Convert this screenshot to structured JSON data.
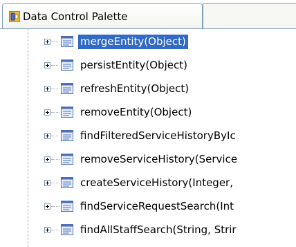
{
  "tab": {
    "title": "Data Control Palette",
    "icon": "data-control-palette-icon"
  },
  "tree": {
    "items": [
      {
        "label": "mergeEntity(Object)",
        "selected": true,
        "icon": "method-icon"
      },
      {
        "label": "persistEntity(Object)",
        "selected": false,
        "icon": "method-icon"
      },
      {
        "label": "refreshEntity(Object)",
        "selected": false,
        "icon": "method-icon"
      },
      {
        "label": "removeEntity(Object)",
        "selected": false,
        "icon": "method-icon"
      },
      {
        "label": "findFilteredServiceHistoryByIc",
        "selected": false,
        "icon": "method-icon"
      },
      {
        "label": "removeServiceHistory(Service",
        "selected": false,
        "icon": "method-icon"
      },
      {
        "label": "createServiceHistory(Integer,",
        "selected": false,
        "icon": "method-icon"
      },
      {
        "label": "findServiceRequestSearch(Int",
        "selected": false,
        "icon": "method-icon"
      },
      {
        "label": "findAllStaffSearch(String, Strir",
        "selected": false,
        "icon": "method-icon"
      }
    ]
  },
  "colors": {
    "selection": "#3169c6",
    "tab_border": "#7f9db9"
  }
}
